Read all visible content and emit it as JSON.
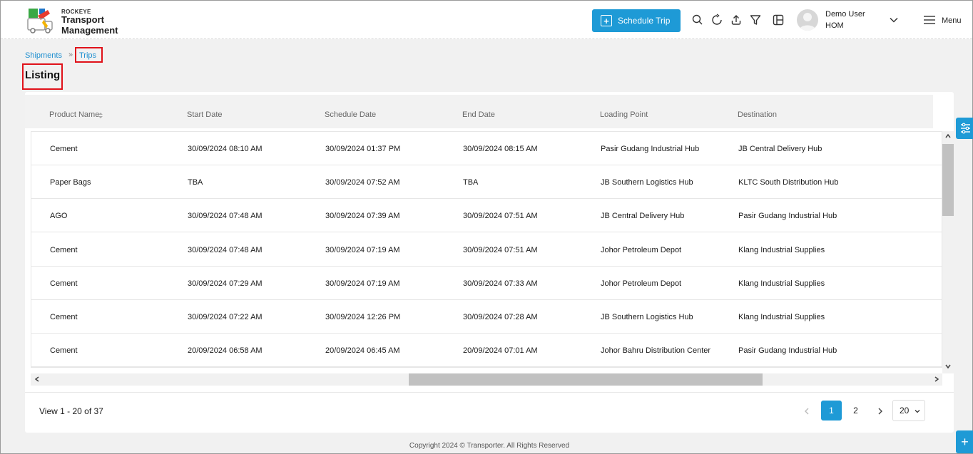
{
  "app": {
    "brand_top": "ROCKEYE",
    "brand_line1": "Transport",
    "brand_line2": "Management"
  },
  "header": {
    "schedule_trip_label": "Schedule Trip",
    "icons": [
      "search-icon",
      "refresh-icon",
      "upload-icon",
      "filter-icon",
      "columns-icon"
    ],
    "user_name": "Demo User",
    "user_org": "HOM",
    "menu_label": "Menu"
  },
  "breadcrumb": {
    "items": [
      "Shipments",
      "Trips"
    ]
  },
  "page": {
    "title": "Listing"
  },
  "table": {
    "columns": [
      "Product Name",
      "Start Date",
      "Schedule Date",
      "End Date",
      "Loading Point",
      "Destination"
    ],
    "rows": [
      [
        "Cement",
        "30/09/2024 08:10 AM",
        "30/09/2024 01:37 PM",
        "30/09/2024 08:15 AM",
        "Pasir Gudang Industrial Hub",
        "JB Central Delivery Hub"
      ],
      [
        "Paper Bags",
        "TBA",
        "30/09/2024 07:52 AM",
        "TBA",
        "JB Southern Logistics Hub",
        "KLTC South Distribution Hub"
      ],
      [
        "AGO",
        "30/09/2024 07:48 AM",
        "30/09/2024 07:39 AM",
        "30/09/2024 07:51 AM",
        "JB Central Delivery Hub",
        "Pasir Gudang Industrial Hub"
      ],
      [
        "Cement",
        "30/09/2024 07:48 AM",
        "30/09/2024 07:19 AM",
        "30/09/2024 07:51 AM",
        "Johor Petroleum Depot",
        "Klang Industrial Supplies"
      ],
      [
        "Cement",
        "30/09/2024 07:29 AM",
        "30/09/2024 07:19 AM",
        "30/09/2024 07:33 AM",
        "Johor Petroleum Depot",
        "Klang Industrial Supplies"
      ],
      [
        "Cement",
        "30/09/2024 07:22 AM",
        "30/09/2024 12:26 PM",
        "30/09/2024 07:28 AM",
        "JB Southern Logistics Hub",
        "Klang Industrial Supplies"
      ],
      [
        "Cement",
        "20/09/2024 06:58 AM",
        "20/09/2024 06:45 AM",
        "20/09/2024 07:01 AM",
        "Johor Bahru Distribution Center",
        "Pasir Gudang Industrial Hub"
      ]
    ]
  },
  "pagination": {
    "view_text": "View 1 - 20 of 37",
    "pages": [
      "1",
      "2"
    ],
    "current_page": "1",
    "page_size": "20"
  },
  "footer": {
    "copyright": "Copyright 2024 © Transporter. All Rights Reserved"
  },
  "colors": {
    "accent": "#1e9ad6",
    "highlight_box": "#e0121a"
  }
}
